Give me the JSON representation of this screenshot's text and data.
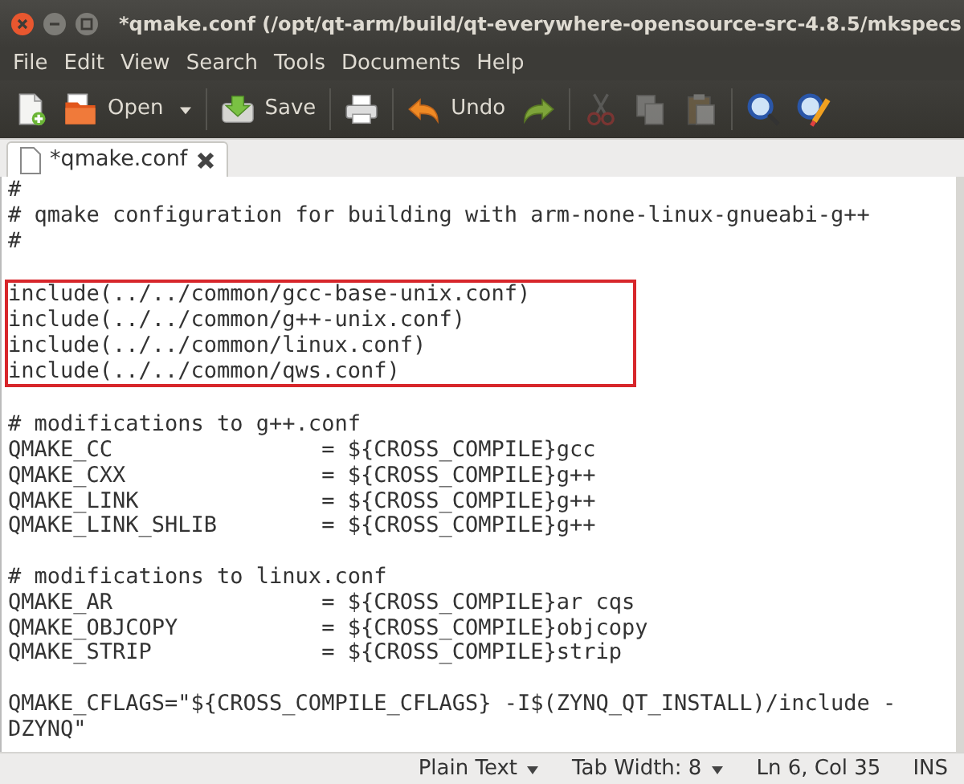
{
  "window": {
    "title": "*qmake.conf (/opt/qt-arm/build/qt-everywhere-opensource-src-4.8.5/mkspecs"
  },
  "menu": [
    "File",
    "Edit",
    "View",
    "Search",
    "Tools",
    "Documents",
    "Help"
  ],
  "toolbar": [
    {
      "kind": "new",
      "disabled": false
    },
    {
      "kind": "open",
      "label": "Open",
      "disabled": false
    },
    {
      "kind": "dropdown",
      "disabled": false
    },
    {
      "kind": "separator"
    },
    {
      "kind": "save",
      "label": "Save",
      "disabled": false
    },
    {
      "kind": "separator"
    },
    {
      "kind": "print",
      "disabled": false
    },
    {
      "kind": "separator"
    },
    {
      "kind": "undo",
      "label": "Undo",
      "disabled": false
    },
    {
      "kind": "redo",
      "disabled": false
    },
    {
      "kind": "separator"
    },
    {
      "kind": "cut",
      "disabled": true
    },
    {
      "kind": "copy",
      "disabled": true
    },
    {
      "kind": "paste",
      "disabled": true
    },
    {
      "kind": "separator"
    },
    {
      "kind": "find",
      "disabled": false
    },
    {
      "kind": "replace",
      "disabled": false
    }
  ],
  "tabs": [
    {
      "label": "*qmake.conf",
      "selected": true
    }
  ],
  "editor": {
    "blocks": [
      {
        "kind": "plain",
        "lines": [
          "#",
          "# qmake configuration for building with arm-none-linux-gnueabi-g++",
          "#"
        ]
      },
      {
        "kind": "boxed",
        "lines": [
          "include(../../common/gcc-base-unix.conf)",
          "include(../../common/g++-unix.conf)",
          "include(../../common/linux.conf)",
          "include(../../common/qws.conf)"
        ]
      },
      {
        "kind": "plain",
        "lines": [
          "# modifications to g++.conf",
          "QMAKE_CC                = ${CROSS_COMPILE}gcc",
          "QMAKE_CXX               = ${CROSS_COMPILE}g++",
          "QMAKE_LINK              = ${CROSS_COMPILE}g++",
          "QMAKE_LINK_SHLIB        = ${CROSS_COMPILE}g++"
        ]
      },
      {
        "kind": "plain",
        "lines": [
          "# modifications to linux.conf",
          "QMAKE_AR                = ${CROSS_COMPILE}ar cqs",
          "QMAKE_OBJCOPY           = ${CROSS_COMPILE}objcopy",
          "QMAKE_STRIP             = ${CROSS_COMPILE}strip"
        ]
      },
      {
        "kind": "plain",
        "lines": [
          "QMAKE_CFLAGS=\"${CROSS_COMPILE_CFLAGS} -I$(ZYNQ_QT_INSTALL)/include -",
          "DZYNQ\""
        ]
      }
    ]
  },
  "status_bar": [
    {
      "kind": "dropdown",
      "text": "Plain Text"
    },
    {
      "kind": "dropdown",
      "text": "Tab Width: 8"
    },
    {
      "kind": "text",
      "text": "Ln 6, Col 35"
    },
    {
      "kind": "text",
      "text": "INS"
    }
  ]
}
